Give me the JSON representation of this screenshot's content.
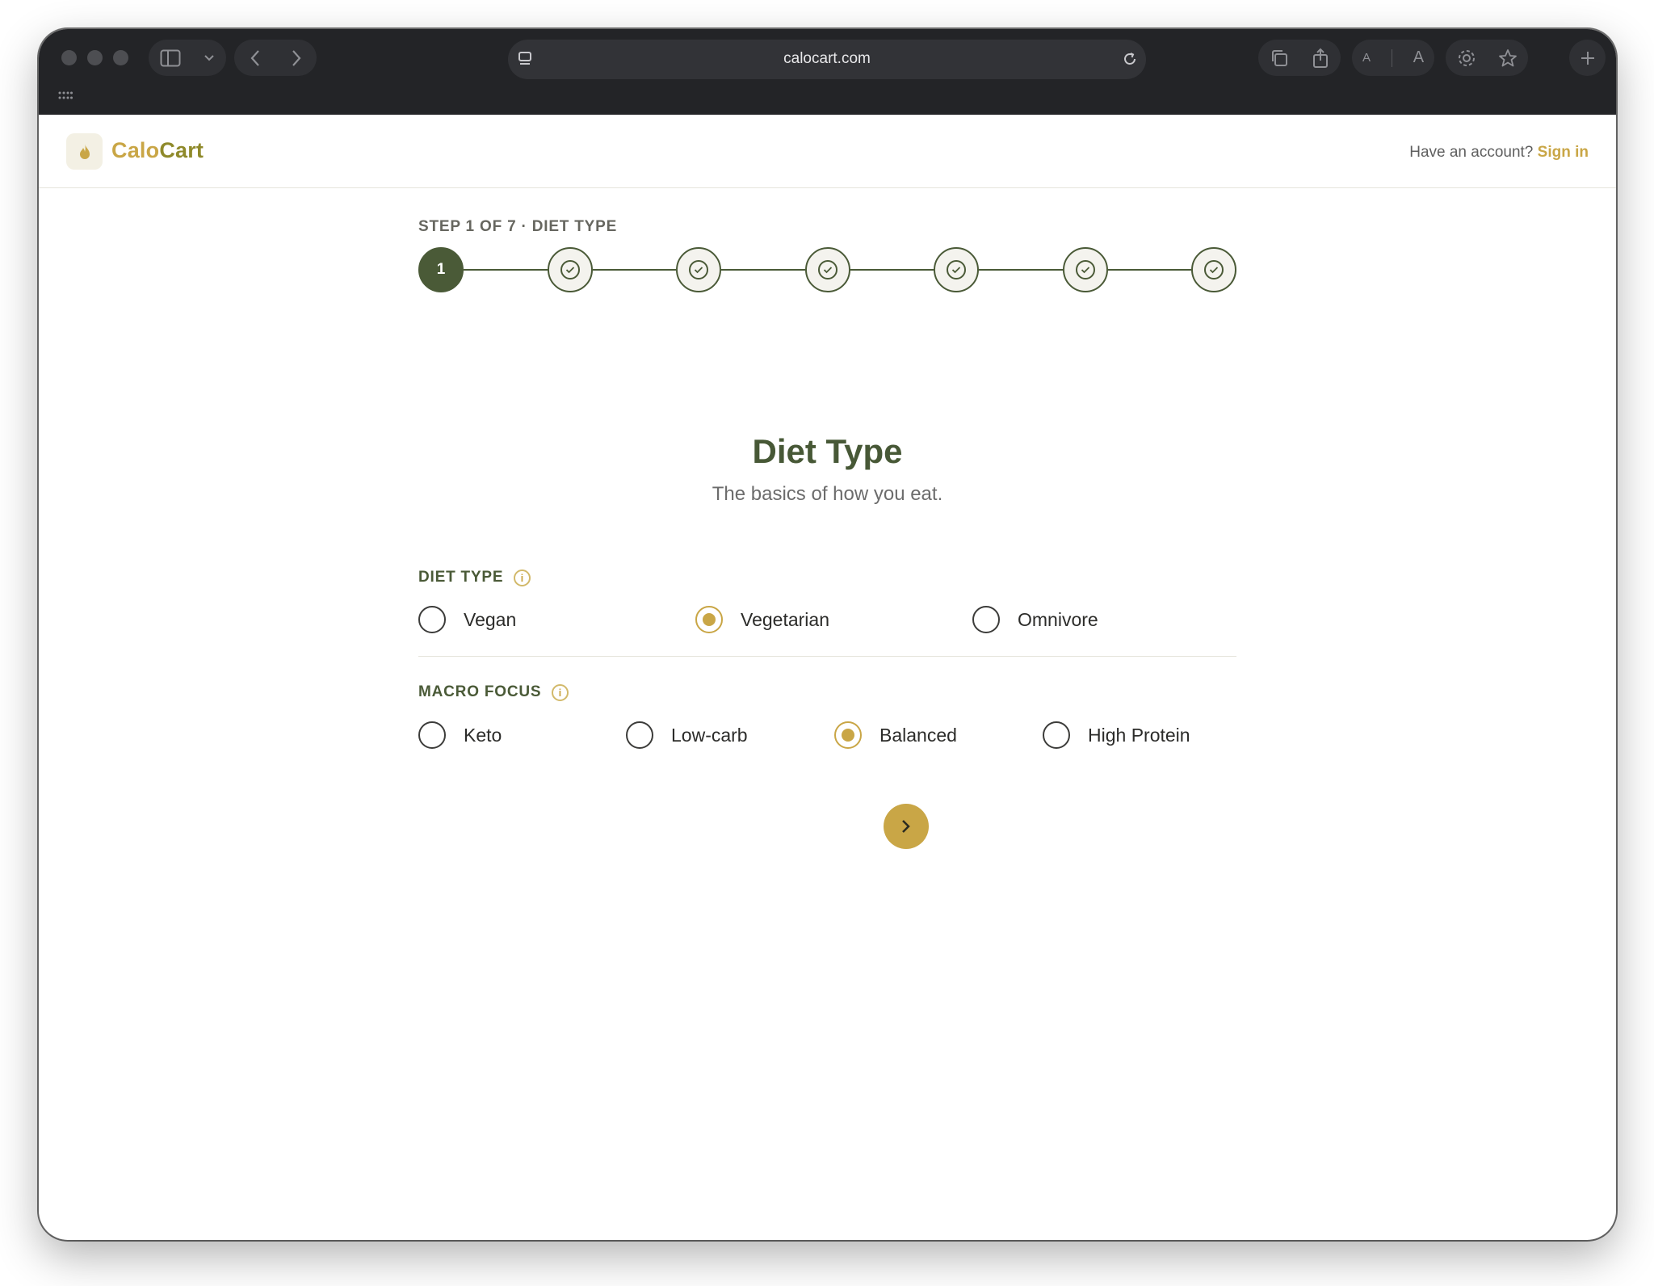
{
  "browser": {
    "url": "calocart.com"
  },
  "brand": {
    "name_part1": "Calo",
    "name_part2": "Cart"
  },
  "header": {
    "account_prompt": "Have an account?",
    "sign_in_label": "Sign in"
  },
  "stepper": {
    "label": "STEP 1 OF 7 · DIET TYPE",
    "current_step": 1,
    "total_steps": 7,
    "active_label": "1"
  },
  "page": {
    "title": "Diet Type",
    "subtitle": "The basics of how you eat."
  },
  "diet_type": {
    "label": "DIET TYPE",
    "options": [
      {
        "label": "Vegan",
        "selected": false
      },
      {
        "label": "Vegetarian",
        "selected": true
      },
      {
        "label": "Omnivore",
        "selected": false
      }
    ]
  },
  "macro_focus": {
    "label": "MACRO FOCUS",
    "options": [
      {
        "label": "Keto",
        "selected": false
      },
      {
        "label": "Low-carb",
        "selected": false
      },
      {
        "label": "Balanced",
        "selected": true
      },
      {
        "label": "High Protein",
        "selected": false
      }
    ]
  },
  "colors": {
    "brand_dark_green": "#4a5a37",
    "accent_gold": "#c9a646"
  },
  "icons": {
    "logo": "flame-icon",
    "info": "info-icon",
    "next": "chevron-right-icon",
    "step_done": "check-circle-icon"
  }
}
